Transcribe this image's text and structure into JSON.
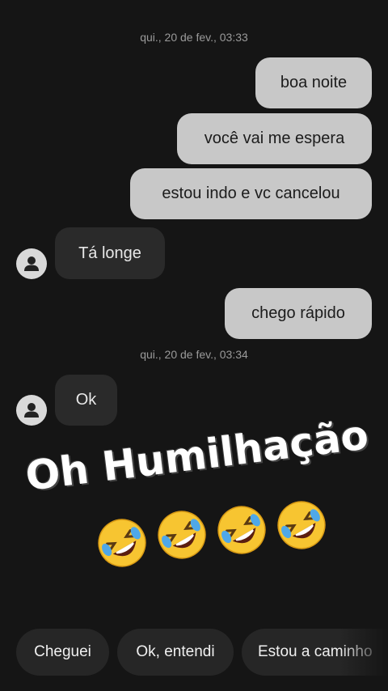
{
  "conversation": {
    "timestamps": [
      "qui., 20 de fev., 03:33",
      "qui., 20 de fev., 03:34"
    ],
    "messages": [
      {
        "from": "me",
        "text": "boa noite"
      },
      {
        "from": "me",
        "text": "você vai me espera"
      },
      {
        "from": "me",
        "text": "estou indo e vc cancelou"
      },
      {
        "from": "other",
        "text": "Tá longe"
      },
      {
        "from": "me",
        "text": "chego rápido"
      },
      {
        "from": "other",
        "text": "Ok"
      }
    ]
  },
  "overlay": {
    "caption": "Oh Humilhação",
    "emoji": "rolling-on-floor-laughing",
    "emoji_count": 4
  },
  "quick_replies": [
    "Cheguei",
    "Ok, entendi",
    "Estou a caminho"
  ],
  "colors": {
    "background": "#151515",
    "outgoing_bubble": "#c8c8c8",
    "incoming_bubble": "#2a2a2a",
    "chip": "#262626"
  }
}
